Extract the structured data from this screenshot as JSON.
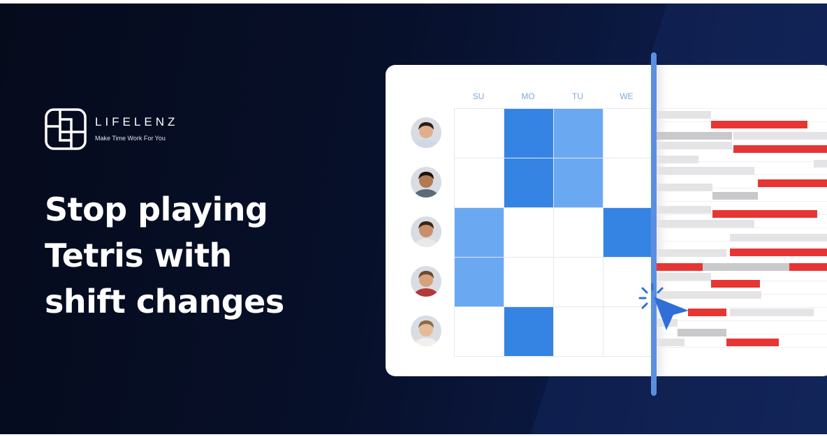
{
  "brand": {
    "name": "LIFELENZ",
    "tagline": "Make Time Work For You",
    "logo_icon": "lifelenz-logo-icon"
  },
  "headline": {
    "lines": [
      "Stop playing",
      "Tetris with",
      "shift changes"
    ]
  },
  "schedule": {
    "days": [
      "SU",
      "MO",
      "TU",
      "WE"
    ],
    "rows": [
      {
        "avatar": "avatar-icon",
        "cells": [
          "empty",
          "blue-dark",
          "blue-light",
          "empty"
        ]
      },
      {
        "avatar": "avatar-icon",
        "cells": [
          "empty",
          "blue-dark",
          "blue-light",
          "empty"
        ]
      },
      {
        "avatar": "avatar-icon",
        "cells": [
          "blue-light",
          "empty",
          "empty",
          "blue-dark"
        ]
      },
      {
        "avatar": "avatar-icon",
        "cells": [
          "blue-light",
          "empty",
          "empty",
          "empty"
        ]
      },
      {
        "avatar": "avatar-icon",
        "cells": [
          "empty",
          "blue-dark",
          "empty",
          "empty"
        ]
      }
    ]
  },
  "colors": {
    "blue_dark": "#3584e4",
    "blue_light": "#6aa8f2",
    "bar_red": "#e73534",
    "bar_grey": "#c9c9cb",
    "bar_lightgrey": "#e4e4e6",
    "divider": "#5a8fe0",
    "cursor": "#2f6fd6"
  },
  "icons": {
    "cursor": "cursor-click-icon"
  }
}
